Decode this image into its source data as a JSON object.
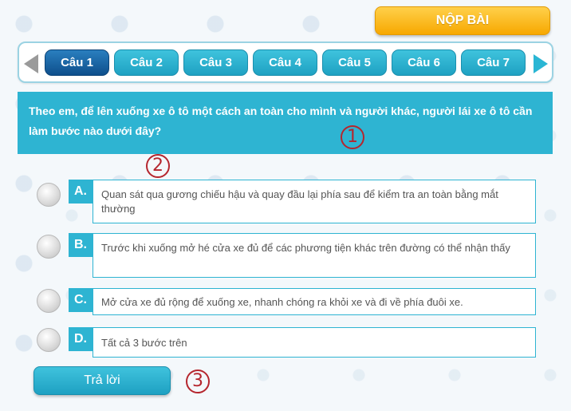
{
  "header": {
    "submit_label": "NỘP BÀI"
  },
  "nav": {
    "prev_icon": "arrow-left-icon",
    "next_icon": "arrow-right-icon",
    "tabs": [
      {
        "label": "Câu 1",
        "active": true
      },
      {
        "label": "Câu 2"
      },
      {
        "label": "Câu 3"
      },
      {
        "label": "Câu 4"
      },
      {
        "label": "Câu 5"
      },
      {
        "label": "Câu 6"
      },
      {
        "label": "Câu 7"
      }
    ]
  },
  "question": {
    "text": "Theo em, để lên xuống xe ô tô một cách an toàn cho mình và người khác, người lái xe ô tô cần làm bước nào dưới đây?"
  },
  "answers": [
    {
      "letter": "A.",
      "text": "Quan sát qua gương chiếu hậu và quay đầu lại phía sau để kiểm tra an toàn bằng mắt thường"
    },
    {
      "letter": "B.",
      "text": "Trước khi xuống mở hé cửa xe đủ để các phương tiện khác trên đường có thể nhận thấy"
    },
    {
      "letter": "C.",
      "text": "Mở cửa xe đủ rộng để xuống xe, nhanh chóng ra khỏi xe và đi về phía đuôi xe."
    },
    {
      "letter": "D.",
      "text": "Tất cả 3 bước trên"
    }
  ],
  "actions": {
    "answer_label": "Trả lời"
  },
  "annotations": {
    "marker_1": "1",
    "marker_2": "2",
    "marker_3": "3"
  },
  "colors": {
    "accent": "#2eb4d2",
    "active_tab": "#0e4f8c",
    "submit": "#f7a800",
    "marker": "#b5262e"
  }
}
